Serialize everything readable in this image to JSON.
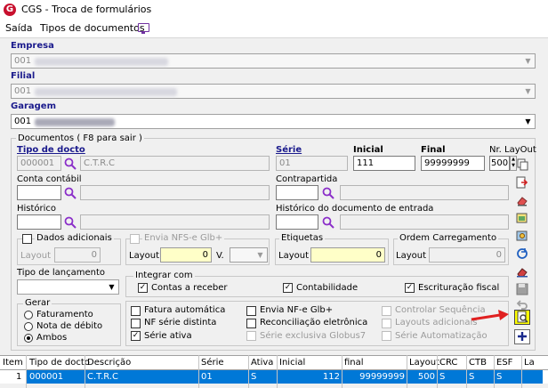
{
  "window": {
    "title": "CGS - Troca de formulários"
  },
  "menu": {
    "saida": "Saída",
    "tipos": "Tipos de documentos"
  },
  "empresa": {
    "label": "Empresa",
    "code": "001"
  },
  "filial": {
    "label": "Filial",
    "code": "001"
  },
  "garagem": {
    "label": "Garagem",
    "code": "001"
  },
  "documentos": {
    "group_title": "Documentos ( F8 para sair )",
    "tipo_docto_label": "Tipo de docto",
    "tipo_docto_code": "000001",
    "tipo_docto_desc": "C.T.R.C",
    "serie_label": "Série",
    "serie_value": "01",
    "inicial_label": "Inicial",
    "inicial_value": "111",
    "final_label": "Final",
    "final_value": "99999999",
    "nr_layout_label": "Nr. LayOut",
    "nr_layout_value": "500",
    "conta_contabil_label": "Conta contábil",
    "contrapartida_label": "Contrapartida",
    "historico_label": "Histórico",
    "historico_entrada_label": "Histórico do documento de entrada",
    "dados_adicionais_label": "Dados adicionais",
    "layout_label": "Layout",
    "dados_layout_value": "0",
    "envia_nfs_label": "Envia NFS-e Glb+",
    "envia_layout_value": "0",
    "v_label": "V.",
    "etiquetas_label": "Etiquetas",
    "etiquetas_layout_value": "0",
    "ordem_label": "Ordem Carregamento",
    "ordem_layout_value": "0",
    "tipo_lancamento_label": "Tipo de lançamento",
    "integrar_label": "Integrar com",
    "contas_receber": "Contas a receber",
    "contabilidade": "Contabilidade",
    "escrituracao": "Escrituração fiscal",
    "gerar_label": "Gerar",
    "faturamento": "Faturamento",
    "nota_debito": "Nota de débito",
    "ambos": "Ambos",
    "fatura_automatica": "Fatura automática",
    "nf_serie_distinta": "NF série distinta",
    "serie_ativa": "Série ativa",
    "envia_nfe_glb": "Envia NF-e Glb+",
    "reconciliacao": "Reconciliação eletrônica",
    "serie_exclusiva": "Série exclusiva Globus7",
    "controlar_sequencia": "Controlar Sequência",
    "layouts_adicionais": "Layouts adicionais",
    "serie_automatizacao": "Série Automatização"
  },
  "grid": {
    "headers": [
      "Item",
      "Tipo de docto",
      "Descrição",
      "Série",
      "Ativa",
      "Inicial",
      "final",
      "Layout",
      "CRC",
      "CTB",
      "ESF",
      "La"
    ],
    "row": {
      "item": "1",
      "tipo": "000001",
      "descricao": "C.T.R.C",
      "serie": "01",
      "ativa": "S",
      "inicial": "112",
      "final": "99999999",
      "layout": "500",
      "crc": "S",
      "ctb": "S",
      "esf": "S"
    }
  },
  "colors": {
    "accent": "#1a1a8c",
    "selection": "#0078d7",
    "highlight": "#ffff00",
    "arrow": "#e02020"
  }
}
